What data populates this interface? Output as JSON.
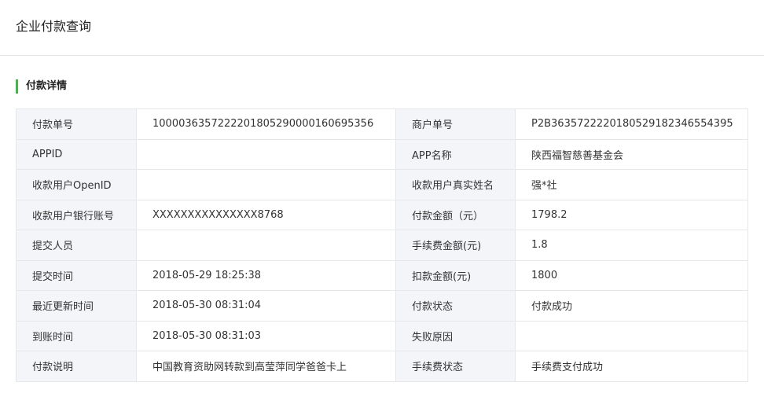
{
  "page": {
    "title": "企业付款查询"
  },
  "section": {
    "title": "付款详情"
  },
  "rows": [
    {
      "l1": "付款单号",
      "v1": "1000036357222201805290000160695356",
      "l2": "商户单号",
      "v2": "P2B363572222018052918234655439​5"
    },
    {
      "l1": "APPID",
      "v1": "",
      "l2": "APP名称",
      "v2": "陕西福智慈善基金会"
    },
    {
      "l1": "收款用户OpenID",
      "v1": "",
      "l2": "收款用户真实姓名",
      "v2": "强*社"
    },
    {
      "l1": "收款用户银行账号",
      "v1": "XXXXXXXXXXXXXXX8768",
      "l2": "付款金额（元）",
      "v2": "1798.2"
    },
    {
      "l1": "提交人员",
      "v1": "",
      "l2": "手续费金额(元)",
      "v2": "1.8"
    },
    {
      "l1": "提交时间",
      "v1": "2018-05-29 18:25:38",
      "l2": "扣款金额(元)",
      "v2": "1800"
    },
    {
      "l1": "最近更新时间",
      "v1": "2018-05-30 08:31:04",
      "l2": "付款状态",
      "v2": "付款成功"
    },
    {
      "l1": "到账时间",
      "v1": "2018-05-30 08:31:03",
      "l2": "失败原因",
      "v2": ""
    },
    {
      "l1": "付款说明",
      "v1": "中国教育资助网转款到高莹萍同学爸爸卡上",
      "l2": "手续费状态",
      "v2": "手续费支付成功"
    }
  ],
  "colors": {
    "accent": "#44b549",
    "label_bg": "#f4f5f9",
    "border": "#e7e7eb"
  }
}
